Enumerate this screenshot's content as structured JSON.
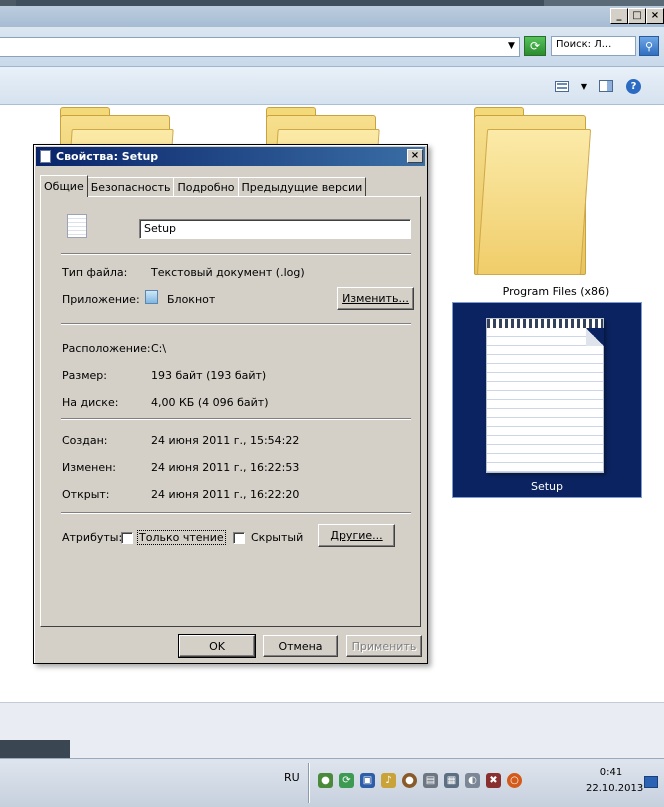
{
  "window": {
    "caption_buttons": {
      "minimize": "_",
      "maximize": "□",
      "close": "×"
    }
  },
  "address": {
    "search_placeholder": "Поиск: Л..."
  },
  "folders": [
    {
      "label": ""
    },
    {
      "label": ""
    },
    {
      "label": "Program Files (x86)"
    }
  ],
  "selected_file": {
    "label": "Setup"
  },
  "dialog": {
    "title": "Свойства: Setup",
    "tabs": [
      {
        "label": "Общие"
      },
      {
        "label": "Безопасность"
      },
      {
        "label": "Подробно"
      },
      {
        "label": "Предыдущие версии"
      }
    ],
    "file_name": "Setup",
    "type_label": "Тип файла:",
    "type_value": "Текстовый документ (.log)",
    "app_label": "Приложение:",
    "app_value": "Блокнот",
    "change_button": "Изменить...",
    "location_label": "Расположение:",
    "location_value": "C:\\",
    "size_label": "Размер:",
    "size_value": "193 байт (193 байт)",
    "disk_label": "На диске:",
    "disk_value": "4,00 КБ (4 096 байт)",
    "created_label": "Создан:",
    "created_value": "24 июня 2011 г., 15:54:22",
    "modified_label": "Изменен:",
    "modified_value": "24 июня 2011 г., 16:22:53",
    "opened_label": "Открыт:",
    "opened_value": "24 июня 2011 г., 16:22:20",
    "attributes_label": "Атрибуты:",
    "readonly_label": "Только чтение",
    "hidden_label": "Скрытый",
    "other_button": "Другие...",
    "ok_button": "OK",
    "cancel_button": "Отмена",
    "apply_button": "Применить"
  },
  "taskbar": {
    "language": "RU",
    "time": "0:41",
    "date": "22.10.2013"
  },
  "colors": {
    "dialog_face": "#d4d0c8",
    "title_active": "#0a246a",
    "selection": "#0b2461"
  }
}
